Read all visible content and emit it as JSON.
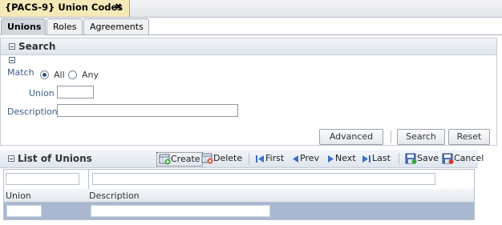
{
  "doc_tab": {
    "title": "{PACS-9} Union Codes",
    "close_glyph": "✖"
  },
  "sub_tabs": [
    {
      "label": "Unions"
    },
    {
      "label": "Roles"
    },
    {
      "label": "Agreements"
    }
  ],
  "search": {
    "title": "Search",
    "match_label": "Match",
    "match_all": "All",
    "match_any": "Any",
    "match_selected": "All",
    "union_label": "Union",
    "union_value": "",
    "description_label": "Description",
    "description_value": "",
    "advanced_button": "Advanced",
    "search_button": "Search",
    "reset_button": "Reset"
  },
  "list": {
    "title": "List of Unions",
    "toolbar": {
      "create": "Create",
      "delete": "Delete",
      "first": "First",
      "prev": "Prev",
      "next": "Next",
      "last": "Last",
      "save": "Save",
      "cancel": "Cancel"
    },
    "columns": [
      "Union",
      "Description"
    ],
    "rows": [
      {
        "union": "",
        "description": ""
      }
    ]
  },
  "colors": {
    "label_blue": "#3b5d86",
    "selected_row": "#a9b8d0",
    "active_doc_tab": "#f6e9b8"
  }
}
